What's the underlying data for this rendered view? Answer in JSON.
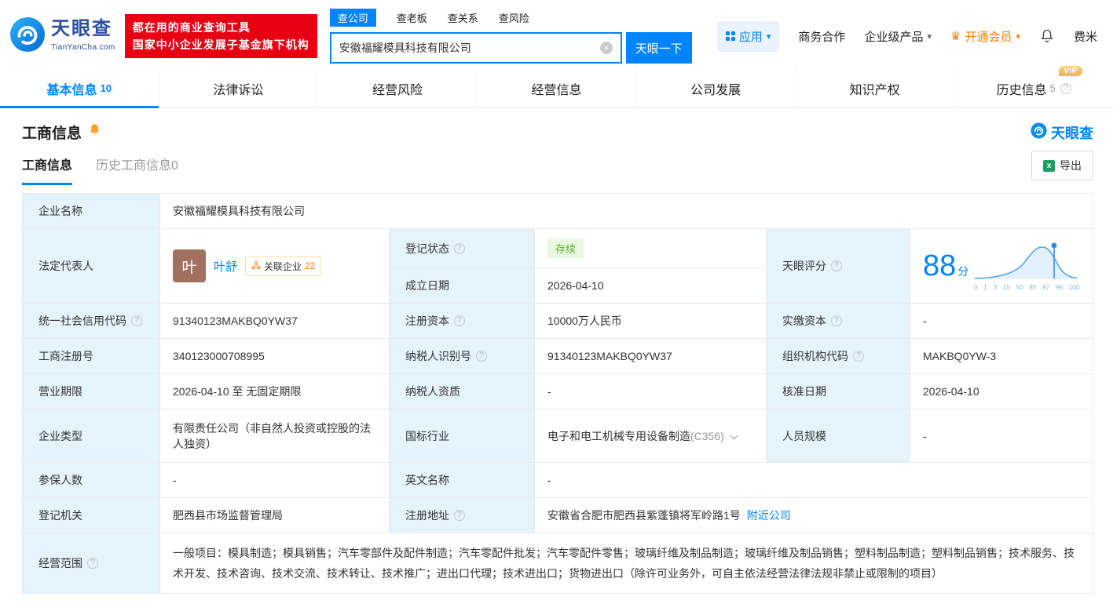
{
  "colors": {
    "brand_blue": "#0084ff",
    "banner_red": "#e60012",
    "vip_orange": "#ff8000",
    "status_green": "#54b12e",
    "label_bg": "#e4f3fc"
  },
  "icons": {
    "help": "?",
    "caret": "▾",
    "clear": "×",
    "crown": "♛",
    "excel": "x"
  },
  "header": {
    "logo": {
      "brand": "天眼查",
      "domain": "TianYanCha.com"
    },
    "slogan": {
      "line1": "都在用的商业查询工具",
      "line2": "国家中小企业发展子基金旗下机构"
    },
    "search": {
      "tabs": [
        {
          "label": "查公司"
        },
        {
          "label": "查老板"
        },
        {
          "label": "查关系"
        },
        {
          "label": "查风险"
        }
      ],
      "value": "安徽福耀模具科技有限公司",
      "button": "天眼一下"
    },
    "nav": {
      "app": "应用",
      "cooperation": "商务合作",
      "enterprise": "企业级产品",
      "vip": "开通会员",
      "user": "费米"
    }
  },
  "tabs": [
    {
      "label": "基本信息",
      "count": "10"
    },
    {
      "label": "法律诉讼"
    },
    {
      "label": "经营风险"
    },
    {
      "label": "经营信息"
    },
    {
      "label": "公司发展"
    },
    {
      "label": "知识产权"
    },
    {
      "label": "历史信息",
      "count": "5",
      "vip": "VIP"
    }
  ],
  "section": {
    "title": "工商信息",
    "logo": "天眼查",
    "subtab_active": "工商信息",
    "subtab_history": "历史工商信息0",
    "export": "导出"
  },
  "info": {
    "labels": {
      "name": "企业名称",
      "legal_rep": "法定代表人",
      "reg_status": "登记状态",
      "score": "天眼评分",
      "establish_date": "成立日期",
      "credit_code": "统一社会信用代码",
      "reg_capital": "注册资本",
      "paid_capital": "实缴资本",
      "reg_number": "工商注册号",
      "taxpayer_id": "纳税人识别号",
      "org_code": "组织机构代码",
      "business_term": "营业期限",
      "taxpayer_quality": "纳税人资质",
      "approval_date": "核准日期",
      "company_type": "企业类型",
      "industry": "国标行业",
      "staff_size": "人员规模",
      "insured_count": "参保人数",
      "english_name": "英文名称",
      "reg_authority": "登记机关",
      "address": "注册地址",
      "business_scope": "经营范围"
    },
    "values": {
      "name": "安徽福耀模具科技有限公司",
      "legal_rep_avatar": "叶",
      "legal_rep": "叶舒",
      "related_label": "关联企业",
      "related_count": "22",
      "reg_status": "存续",
      "score": "88",
      "score_unit": "分",
      "score_axis": [
        "0",
        "1",
        "3",
        "15",
        "50",
        "85",
        "97",
        "99",
        "100"
      ],
      "establish_date": "2026-04-10",
      "credit_code": "91340123MAKBQ0YW37",
      "reg_capital": "10000万人民币",
      "paid_capital": "-",
      "reg_number": "340123000708995",
      "taxpayer_id": "91340123MAKBQ0YW37",
      "org_code": "MAKBQ0YW-3",
      "business_term": "2026-04-10 至 无固定期限",
      "taxpayer_quality": "-",
      "approval_date": "2026-04-10",
      "company_type": "有限责任公司（非自然人投资或控股的法人独资）",
      "industry": "电子和电工机械专用设备制造",
      "industry_code": "(C356)",
      "staff_size": "-",
      "insured_count": "-",
      "english_name": "-",
      "reg_authority": "肥西县市场监督管理局",
      "address": "安徽省合肥市肥西县紫蓬镇将军岭路1号",
      "nearby_link": "附近公司",
      "business_scope": "一般项目：模具制造；模具销售；汽车零部件及配件制造；汽车零配件批发；汽车零配件零售；玻璃纤维及制品制造；玻璃纤维及制品销售；塑料制品制造；塑料制品销售；技术服务、技术开发、技术咨询、技术交流、技术转让、技术推广；进出口代理；技术进出口；货物进出口（除许可业务外，可自主依法经营法律法规非禁止或限制的项目）"
    }
  }
}
